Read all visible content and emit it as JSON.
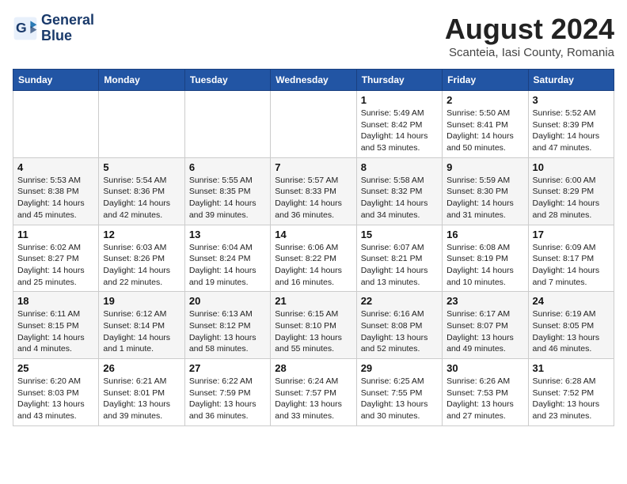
{
  "header": {
    "logo_line1": "General",
    "logo_line2": "Blue",
    "month": "August 2024",
    "location": "Scanteia, Iasi County, Romania"
  },
  "weekdays": [
    "Sunday",
    "Monday",
    "Tuesday",
    "Wednesday",
    "Thursday",
    "Friday",
    "Saturday"
  ],
  "weeks": [
    [
      {
        "day": "",
        "info": ""
      },
      {
        "day": "",
        "info": ""
      },
      {
        "day": "",
        "info": ""
      },
      {
        "day": "",
        "info": ""
      },
      {
        "day": "1",
        "info": "Sunrise: 5:49 AM\nSunset: 8:42 PM\nDaylight: 14 hours\nand 53 minutes."
      },
      {
        "day": "2",
        "info": "Sunrise: 5:50 AM\nSunset: 8:41 PM\nDaylight: 14 hours\nand 50 minutes."
      },
      {
        "day": "3",
        "info": "Sunrise: 5:52 AM\nSunset: 8:39 PM\nDaylight: 14 hours\nand 47 minutes."
      }
    ],
    [
      {
        "day": "4",
        "info": "Sunrise: 5:53 AM\nSunset: 8:38 PM\nDaylight: 14 hours\nand 45 minutes."
      },
      {
        "day": "5",
        "info": "Sunrise: 5:54 AM\nSunset: 8:36 PM\nDaylight: 14 hours\nand 42 minutes."
      },
      {
        "day": "6",
        "info": "Sunrise: 5:55 AM\nSunset: 8:35 PM\nDaylight: 14 hours\nand 39 minutes."
      },
      {
        "day": "7",
        "info": "Sunrise: 5:57 AM\nSunset: 8:33 PM\nDaylight: 14 hours\nand 36 minutes."
      },
      {
        "day": "8",
        "info": "Sunrise: 5:58 AM\nSunset: 8:32 PM\nDaylight: 14 hours\nand 34 minutes."
      },
      {
        "day": "9",
        "info": "Sunrise: 5:59 AM\nSunset: 8:30 PM\nDaylight: 14 hours\nand 31 minutes."
      },
      {
        "day": "10",
        "info": "Sunrise: 6:00 AM\nSunset: 8:29 PM\nDaylight: 14 hours\nand 28 minutes."
      }
    ],
    [
      {
        "day": "11",
        "info": "Sunrise: 6:02 AM\nSunset: 8:27 PM\nDaylight: 14 hours\nand 25 minutes."
      },
      {
        "day": "12",
        "info": "Sunrise: 6:03 AM\nSunset: 8:26 PM\nDaylight: 14 hours\nand 22 minutes."
      },
      {
        "day": "13",
        "info": "Sunrise: 6:04 AM\nSunset: 8:24 PM\nDaylight: 14 hours\nand 19 minutes."
      },
      {
        "day": "14",
        "info": "Sunrise: 6:06 AM\nSunset: 8:22 PM\nDaylight: 14 hours\nand 16 minutes."
      },
      {
        "day": "15",
        "info": "Sunrise: 6:07 AM\nSunset: 8:21 PM\nDaylight: 14 hours\nand 13 minutes."
      },
      {
        "day": "16",
        "info": "Sunrise: 6:08 AM\nSunset: 8:19 PM\nDaylight: 14 hours\nand 10 minutes."
      },
      {
        "day": "17",
        "info": "Sunrise: 6:09 AM\nSunset: 8:17 PM\nDaylight: 14 hours\nand 7 minutes."
      }
    ],
    [
      {
        "day": "18",
        "info": "Sunrise: 6:11 AM\nSunset: 8:15 PM\nDaylight: 14 hours\nand 4 minutes."
      },
      {
        "day": "19",
        "info": "Sunrise: 6:12 AM\nSunset: 8:14 PM\nDaylight: 14 hours\nand 1 minute."
      },
      {
        "day": "20",
        "info": "Sunrise: 6:13 AM\nSunset: 8:12 PM\nDaylight: 13 hours\nand 58 minutes."
      },
      {
        "day": "21",
        "info": "Sunrise: 6:15 AM\nSunset: 8:10 PM\nDaylight: 13 hours\nand 55 minutes."
      },
      {
        "day": "22",
        "info": "Sunrise: 6:16 AM\nSunset: 8:08 PM\nDaylight: 13 hours\nand 52 minutes."
      },
      {
        "day": "23",
        "info": "Sunrise: 6:17 AM\nSunset: 8:07 PM\nDaylight: 13 hours\nand 49 minutes."
      },
      {
        "day": "24",
        "info": "Sunrise: 6:19 AM\nSunset: 8:05 PM\nDaylight: 13 hours\nand 46 minutes."
      }
    ],
    [
      {
        "day": "25",
        "info": "Sunrise: 6:20 AM\nSunset: 8:03 PM\nDaylight: 13 hours\nand 43 minutes."
      },
      {
        "day": "26",
        "info": "Sunrise: 6:21 AM\nSunset: 8:01 PM\nDaylight: 13 hours\nand 39 minutes."
      },
      {
        "day": "27",
        "info": "Sunrise: 6:22 AM\nSunset: 7:59 PM\nDaylight: 13 hours\nand 36 minutes."
      },
      {
        "day": "28",
        "info": "Sunrise: 6:24 AM\nSunset: 7:57 PM\nDaylight: 13 hours\nand 33 minutes."
      },
      {
        "day": "29",
        "info": "Sunrise: 6:25 AM\nSunset: 7:55 PM\nDaylight: 13 hours\nand 30 minutes."
      },
      {
        "day": "30",
        "info": "Sunrise: 6:26 AM\nSunset: 7:53 PM\nDaylight: 13 hours\nand 27 minutes."
      },
      {
        "day": "31",
        "info": "Sunrise: 6:28 AM\nSunset: 7:52 PM\nDaylight: 13 hours\nand 23 minutes."
      }
    ]
  ]
}
